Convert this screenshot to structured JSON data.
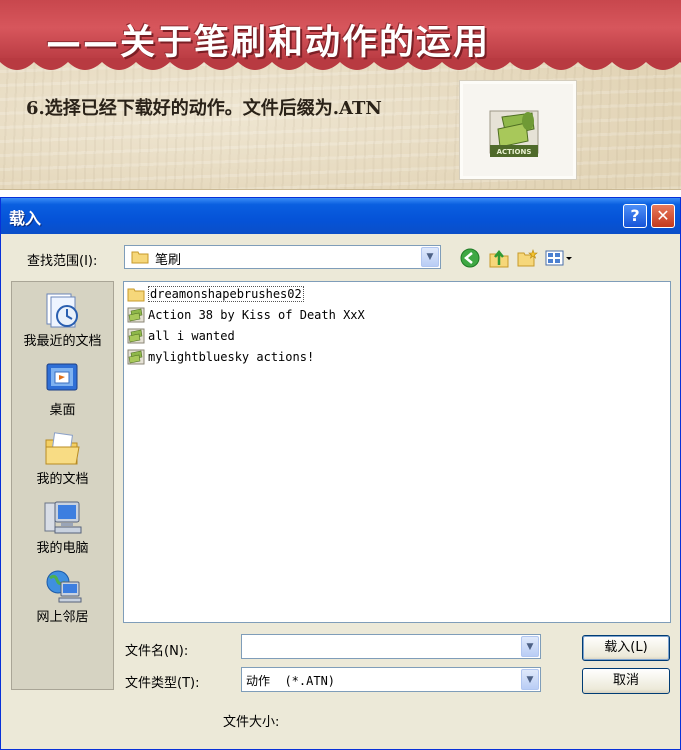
{
  "banner": {
    "title": "——关于笔刷和动作的运用",
    "step_text": "6.选择已经下载好的动作。文件后缀为.ATN",
    "thumbnail_label": "ACTIONS"
  },
  "dialog": {
    "title": "载入",
    "help_label": "?",
    "close_label": "✕",
    "look_in_label": "查找范围(I):",
    "look_in_value": "笔刷",
    "places": [
      {
        "label": "我最近的文档",
        "icon": "recent-documents-icon"
      },
      {
        "label": "桌面",
        "icon": "desktop-icon"
      },
      {
        "label": "我的文档",
        "icon": "my-documents-icon"
      },
      {
        "label": "我的电脑",
        "icon": "my-computer-icon"
      },
      {
        "label": "网上邻居",
        "icon": "network-places-icon"
      }
    ],
    "files": [
      {
        "name": "dreamonshapebrushes02",
        "type": "folder"
      },
      {
        "name": "Action 38 by Kiss of Death XxX",
        "type": "action"
      },
      {
        "name": "all i wanted",
        "type": "action"
      },
      {
        "name": "mylightbluesky actions!",
        "type": "action"
      }
    ],
    "file_name_label": "文件名(N):",
    "file_name_value": "",
    "file_type_label": "文件类型(T):",
    "file_type_value": "动作  (*.ATN)",
    "file_size_label": "文件大小:",
    "load_button": "载入(L)",
    "cancel_button": "取消"
  },
  "colors": {
    "banner_red": "#c8474d",
    "titlebar_blue": "#0553d8",
    "dialog_face": "#ece9d8"
  }
}
